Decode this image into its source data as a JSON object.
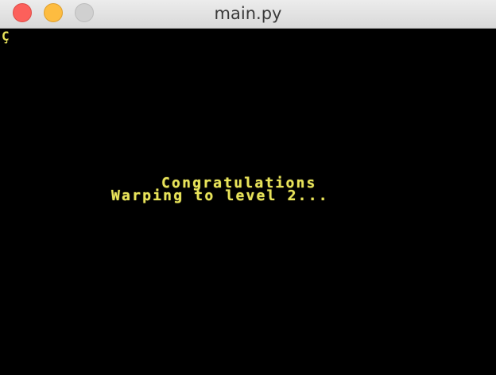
{
  "window": {
    "title": "main.py"
  },
  "game": {
    "corner_glyph": "Ç",
    "message_line1": "Congratulations",
    "message_line2": "Warping to level 2...",
    "text_color": "#e8e35a",
    "background_color": "#000000"
  },
  "icons": {
    "close": "close-button",
    "minimize": "minimize-button",
    "zoom": "zoom-button"
  }
}
